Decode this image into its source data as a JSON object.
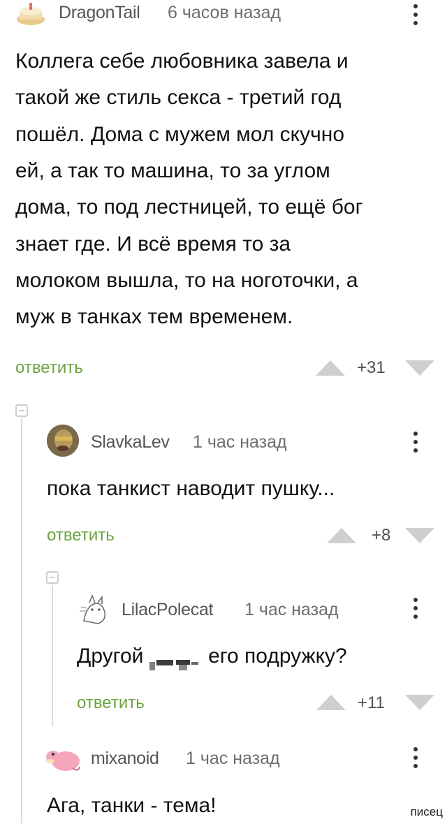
{
  "comments": [
    {
      "nick": "DragonTail",
      "time": "6 часов назад",
      "text_lines": [
        "Коллега себе любовника завела и",
        "такой же стиль секса - третий год",
        "пошёл. Дома с мужем мол скучно",
        "ей, а так то машина, то за углом",
        "дома, то под лестницей, то ещё бог",
        "знает где. И всё время то за",
        "молоком вышла, то на ноготочки, а",
        "муж в танках тем временем."
      ],
      "reply_label": "ответить",
      "score": "+31"
    },
    {
      "nick": "SlavkaLev",
      "time": "1 час назад",
      "text": "пока танкист наводит пушку...",
      "reply_label": "ответить",
      "score": "+8"
    },
    {
      "nick": "LilacPolecat",
      "time": "1 час назад",
      "text_before": "Другой ",
      "text_after": " его подружку?",
      "reply_label": "ответить",
      "score": "+11"
    },
    {
      "nick": "mixanoid",
      "time": "1 час назад",
      "text": "Ага, танки - тема!"
    }
  ],
  "watermark": "писец",
  "colors": {
    "accent_green": "#6aa541",
    "meta_gray": "#6d6d6d",
    "thread_gray": "#dcdcdc"
  },
  "icons": [
    "kebab-menu-icon",
    "upvote-triangle-icon",
    "downvote-triangle-icon",
    "collapse-thread-icon",
    "censor-blur-icon"
  ]
}
